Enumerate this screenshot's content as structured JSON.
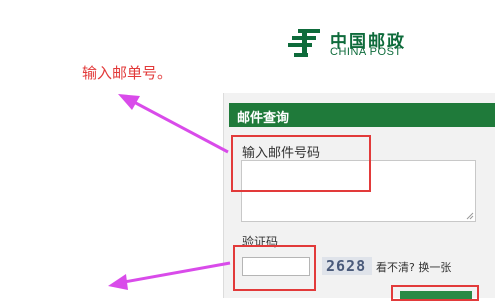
{
  "logo": {
    "name_cn": "中国邮政",
    "name_en": "CHINA POST",
    "color": "#0e6b3b"
  },
  "annotation": {
    "text": "输入邮单号。",
    "color": "#e23a3a"
  },
  "panel": {
    "title": "邮件查询",
    "header_color": "#1f7a3a",
    "tracking_label": "输入邮件号码",
    "tracking_value": "",
    "captcha_label": "验证码",
    "captcha_value": "",
    "captcha_code": "2628",
    "refresh_text": "看不清? 换一张"
  }
}
